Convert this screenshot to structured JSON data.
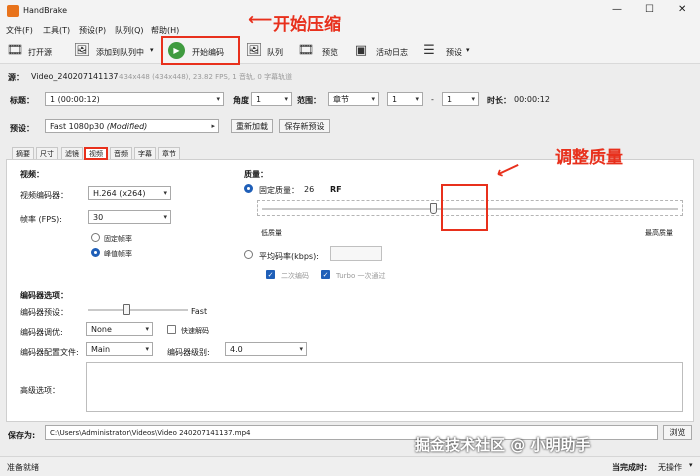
{
  "window": {
    "title": "HandBrake",
    "min": "—",
    "max": "☐",
    "close": "✕"
  },
  "menu": [
    "文件(F)",
    "工具(T)",
    "预设(P)",
    "队列(Q)",
    "帮助(H)"
  ],
  "toolbar": {
    "open": "打开源",
    "add_queue": "添加到队列中",
    "start": "开始编码",
    "queue": "队列",
    "preview": "预览",
    "activity": "活动日志",
    "presets": "预设"
  },
  "annotations": {
    "start": "开始压缩",
    "quality": "调整质量"
  },
  "source": {
    "label": "源：",
    "name": "Video_240207141137",
    "info": "434x448 (434x448), 23.82 FPS, 1 音轨, 0 字幕轨道"
  },
  "title_row": {
    "title_label": "标题：",
    "title_value": "1 (00:00:12)",
    "angle_label": "角度",
    "angle_value": "1",
    "range_label": "范围：",
    "range_type": "章节",
    "range_from": "1",
    "dash": "-",
    "range_to": "1",
    "duration_label": "时长：",
    "duration_value": "00:00:12"
  },
  "preset_row": {
    "label": "预设：",
    "value": "Fast 1080p30",
    "modified": "(Modified)",
    "reload": "重新加载",
    "save_new": "保存新预设"
  },
  "tabs": [
    "摘要",
    "尺寸",
    "滤镜",
    "视频",
    "音频",
    "字幕",
    "章节"
  ],
  "video": {
    "heading": "视频：",
    "codec_label": "视频编码器：",
    "codec_value": "H.264 (x264)",
    "fps_label": "帧率 (FPS):",
    "fps_value": "30",
    "constant_fps": "固定帧率",
    "peak_fps": "峰值帧率"
  },
  "quality": {
    "heading": "质量：",
    "constant_label": "固定质量：",
    "rf_value": "26",
    "rf_unit": "RF",
    "low": "低质量",
    "high": "最高质量",
    "avg_bitrate_label": "平均码率(kbps):",
    "two_pass": "二次编码",
    "turbo": "Turbo 一次通过",
    "slider_fraction": 0.41
  },
  "encoder": {
    "heading": "编码器选项：",
    "preset_label": "编码器预设：",
    "preset_value": "Fast",
    "preset_fraction": 0.38,
    "tune_label": "编码器调优:",
    "tune_value": "None",
    "fast_decode": "快速解码",
    "profile_label": "编码器配置文件:",
    "profile_value": "Main",
    "level_label": "编码器级别:",
    "level_value": "4.0",
    "advanced_label": "高级选项："
  },
  "save": {
    "label": "保存为:",
    "path": "C:\\Users\\Administrator\\Videos\\Video 240207141137.mp4",
    "browse": "浏览"
  },
  "status": {
    "left": "准备就绪",
    "when_done_label": "当完成时:",
    "when_done_value": "无操作"
  },
  "watermark": "掘金技术社区 @ 小明助手",
  "colors": {
    "accent": "#1f5fb8",
    "annotation": "#e8301c",
    "start_green": "#3f9b3f"
  }
}
